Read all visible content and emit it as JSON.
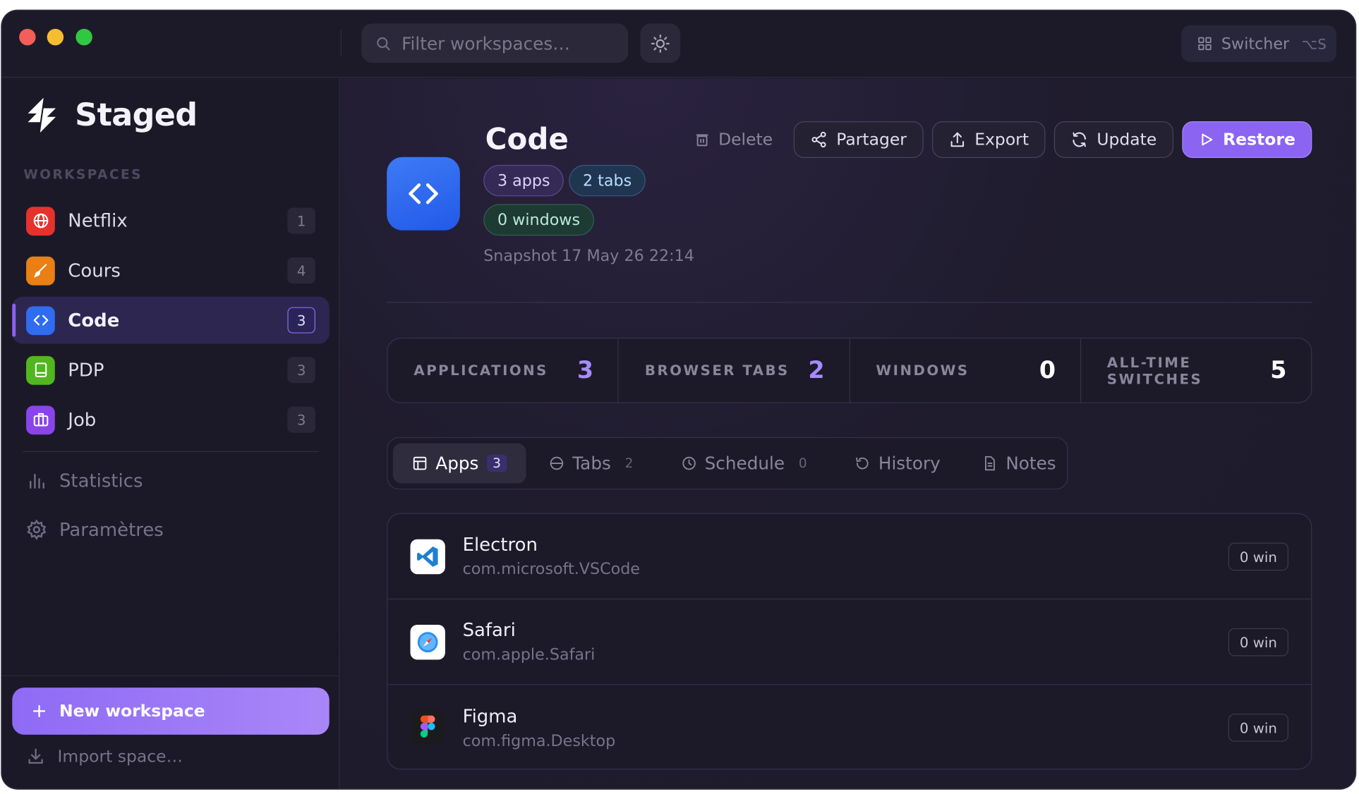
{
  "titlebar": {
    "search_placeholder": "Filter workspaces…",
    "switcher_label": "Switcher",
    "switcher_shortcut": "⌥S"
  },
  "sidebar": {
    "brand": "Staged",
    "section_label": "WORKSPACES",
    "workspaces": [
      {
        "label": "Netflix",
        "count": "1",
        "icon": "globe-icon",
        "color": "#e5322d"
      },
      {
        "label": "Cours",
        "count": "4",
        "icon": "brush-icon",
        "color": "#e97f15"
      },
      {
        "label": "Code",
        "count": "3",
        "icon": "code-icon",
        "color": "#2f6cf0",
        "active": true
      },
      {
        "label": "PDP",
        "count": "3",
        "icon": "tablet-icon",
        "color": "#52b61f"
      },
      {
        "label": "Job",
        "count": "3",
        "icon": "briefcase-icon",
        "color": "#8a44ea"
      }
    ],
    "nav": [
      {
        "label": "Statistics",
        "icon": "bar-chart-icon"
      },
      {
        "label": "Paramètres",
        "icon": "gear-icon"
      }
    ],
    "new_workspace": "New workspace",
    "import": "Import space…"
  },
  "main": {
    "title": "Code",
    "chips": {
      "apps": "3 apps",
      "tabs": "2 tabs",
      "windows": "0 windows"
    },
    "snapshot": "Snapshot 17 May 26 22:14",
    "actions": {
      "delete": "Delete",
      "share": "Partager",
      "export": "Export",
      "update": "Update",
      "restore": "Restore"
    },
    "stats": [
      {
        "label": "APPLICATIONS",
        "value": "3",
        "color": "#a68bff"
      },
      {
        "label": "BROWSER TABS",
        "value": "2",
        "color": "#a68bff"
      },
      {
        "label": "WINDOWS",
        "value": "0",
        "color": "#ffffff"
      },
      {
        "label": "ALL-TIME SWITCHES",
        "value": "5",
        "color": "#ffffff"
      }
    ],
    "tabs": [
      {
        "label": "Apps",
        "count": "3",
        "active": true
      },
      {
        "label": "Tabs",
        "count": "2"
      },
      {
        "label": "Schedule",
        "count": "0"
      },
      {
        "label": "History"
      },
      {
        "label": "Notes"
      }
    ],
    "apps": [
      {
        "name": "Electron",
        "bundle": "com.microsoft.VSCode",
        "windows": "0 win"
      },
      {
        "name": "Safari",
        "bundle": "com.apple.Safari",
        "windows": "0 win"
      },
      {
        "name": "Figma",
        "bundle": "com.figma.Desktop",
        "windows": "0 win"
      }
    ]
  }
}
